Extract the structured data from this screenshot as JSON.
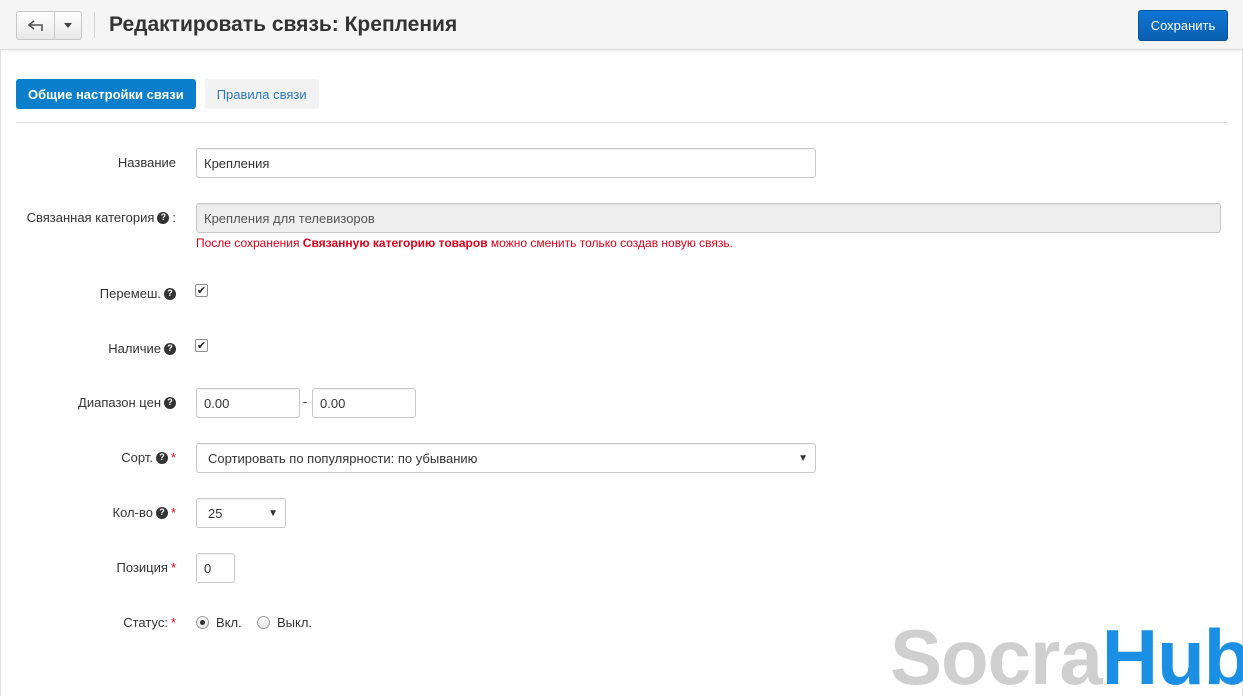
{
  "header": {
    "title": "Редактировать связь: Крепления",
    "save_label": "Сохранить"
  },
  "tabs": [
    {
      "label": "Общие настройки связи",
      "active": true
    },
    {
      "label": "Правила связи",
      "active": false
    }
  ],
  "form": {
    "name": {
      "label": "Название",
      "value": "Крепления"
    },
    "category": {
      "label": "Связанная категория",
      "colon": ":",
      "value": "Крепления для телевизоров",
      "note_pre": "После сохранения ",
      "note_bold": "Связанную категорию товаров",
      "note_post": " можно сменить только создав новую связь."
    },
    "shuffle": {
      "label": "Перемеш.",
      "checked": true
    },
    "availability": {
      "label": "Наличие",
      "checked": true
    },
    "price_range": {
      "label": "Диапазон цен",
      "from": "0.00",
      "separator": "-",
      "to": "0.00"
    },
    "sort": {
      "label": "Сорт.",
      "value": "Сортировать по популярности: по убыванию"
    },
    "count": {
      "label": "Кол-во",
      "value": "25"
    },
    "position": {
      "label": "Позиция",
      "value": "0"
    },
    "status": {
      "label": "Статус:",
      "on_label": "Вкл.",
      "off_label": "Выкл.",
      "selected": "on"
    },
    "required_mark": "*"
  },
  "watermark": {
    "part1": "Socra",
    "part2": "Hub"
  },
  "icons": {
    "back": "back-arrow-icon",
    "dropdown": "caret-down-icon",
    "help": "question-circle-icon"
  },
  "colors": {
    "primary": "#0b7fcc",
    "save": "#0a65bd",
    "required": "#d9001b",
    "watermark_blue": "#1a8fe3"
  }
}
